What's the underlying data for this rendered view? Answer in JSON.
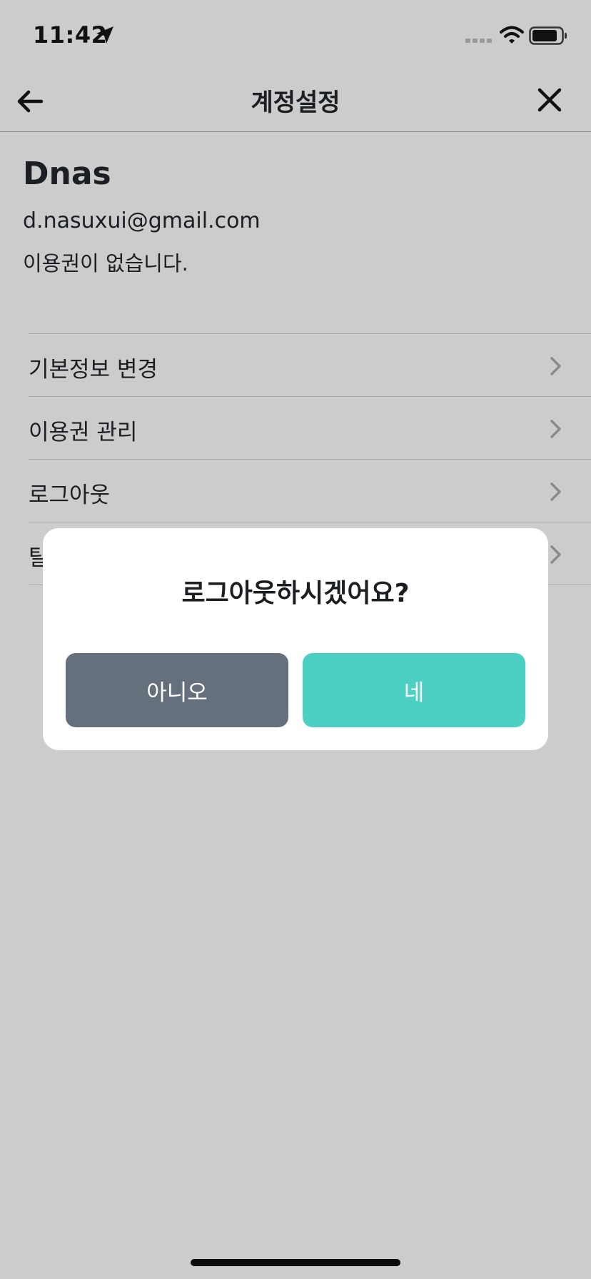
{
  "status_bar": {
    "time": "11:42"
  },
  "header": {
    "title": "계정설정"
  },
  "profile": {
    "name": "Dnas",
    "email": "d.nasuxui@gmail.com",
    "subscription_status": "이용권이 없습니다."
  },
  "menu": {
    "items": [
      {
        "label": "기본정보 변경"
      },
      {
        "label": "이용권 관리"
      },
      {
        "label": "로그아웃"
      },
      {
        "label": "탈"
      }
    ]
  },
  "dialog": {
    "message": "로그아웃하시겠어요?",
    "no_label": "아니오",
    "yes_label": "네"
  },
  "colors": {
    "overlay_background": "#cccccc",
    "dialog_background": "#ffffff",
    "no_button": "#66707d",
    "yes_button": "#4dd0c4",
    "text_primary": "#1b1e22"
  },
  "icons": {
    "back": "arrow-left-icon",
    "close": "close-icon",
    "menu_chevron": "chevron-right-icon",
    "location": "location-arrow-icon",
    "signal": "cellular-signal-icon",
    "wifi": "wifi-icon",
    "battery": "battery-icon"
  }
}
